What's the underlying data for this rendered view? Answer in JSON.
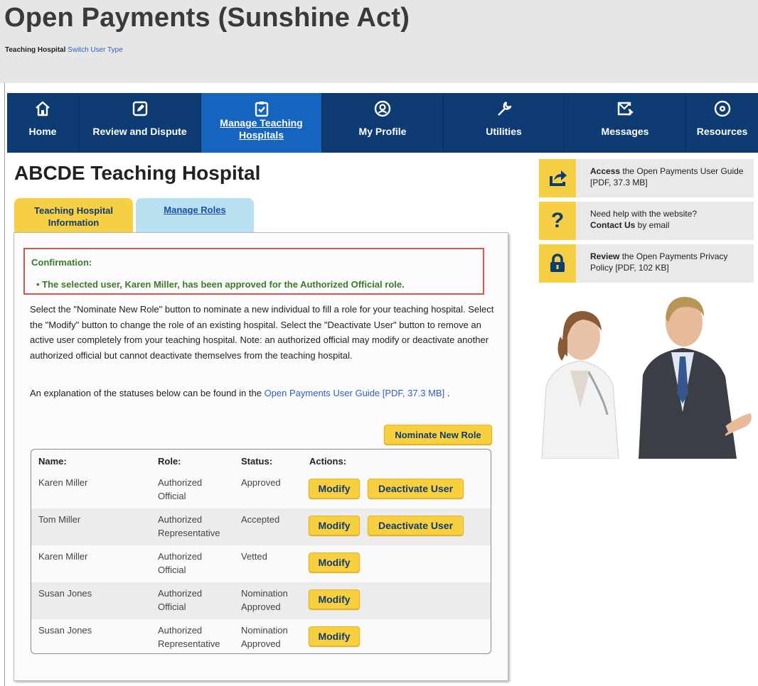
{
  "header": {
    "title": "Open Payments (Sunshine Act)",
    "user_type": "Teaching Hospital",
    "switch_link": "Switch User Type"
  },
  "nav": {
    "items": [
      {
        "label": "Home",
        "icon": "home-icon"
      },
      {
        "label": "Review and Dispute",
        "icon": "edit-icon"
      },
      {
        "label": "Manage Teaching Hospitals",
        "icon": "clipboard-icon",
        "active": true
      },
      {
        "label": "My Profile",
        "icon": "user-icon"
      },
      {
        "label": "Utilities",
        "icon": "wrench-icon"
      },
      {
        "label": "Messages",
        "icon": "mail-icon"
      },
      {
        "label": "Resources",
        "icon": "gear-icon"
      }
    ],
    "active_label_line1": "Manage Teaching",
    "active_label_line2": "Hospitals"
  },
  "main": {
    "title": "ABCDE Teaching Hospital",
    "tabs": {
      "info_line1": "Teaching Hospital",
      "info_line2": "Information",
      "roles": "Manage Roles"
    },
    "confirmation": {
      "title": "Confirmation:",
      "message": "The selected user, Karen Miller, has been approved for the Authorized Official role."
    },
    "instructions": "Select the \"Nominate New Role\" button to nominate a new individual to fill a role for your teaching hospital. Select the \"Modify\" button to change the role of an existing hospital. Select the \"Deactivate User\" button to remove an active user completely from your teaching hospital. Note: an authorized official may modify or deactivate another authorized official but cannot deactivate themselves from the teaching hospital.",
    "explanation_prefix": "An explanation of the statuses below can be found in the",
    "explanation_link": "Open Payments User Guide [PDF, 37.3 MB]",
    "explanation_suffix": ".",
    "nominate_label": "Nominate New Role",
    "table": {
      "headers": {
        "name": "Name:",
        "role": "Role:",
        "status": "Status:",
        "actions": "Actions:"
      },
      "modify_label": "Modify",
      "deactivate_label": "Deactivate User",
      "rows": [
        {
          "name": "Karen Miller",
          "role_line1": "Authorized",
          "role_line2": "Official",
          "status_line1": "Approved",
          "status_line2": ""
        },
        {
          "name": "Tom Miller",
          "role_line1": "Authorized",
          "role_line2": "Representative",
          "status_line1": "Accepted",
          "status_line2": ""
        },
        {
          "name": "Karen Miller",
          "role_line1": "Authorized",
          "role_line2": "Official",
          "status_line1": "Vetted",
          "status_line2": ""
        },
        {
          "name": "Susan Jones",
          "role_line1": "Authorized",
          "role_line2": "Official",
          "status_line1": "Nomination",
          "status_line2": "Approved"
        },
        {
          "name": "Susan Jones",
          "role_line1": "Authorized",
          "role_line2": "Representative",
          "status_line1": "Nomination",
          "status_line2": "Approved"
        }
      ]
    }
  },
  "rail": {
    "guide": {
      "bold": "Access",
      "text": " the Open Payments User Guide [PDF, 37.3 MB]"
    },
    "help": {
      "line1": "Need help with the website?",
      "bold": "Contact Us",
      "text": " by email"
    },
    "privacy": {
      "bold": "Review",
      "text": " the Open Payments Privacy Policy [PDF, 102 KB]"
    }
  },
  "colors": {
    "nav_bg": "#0e3c72",
    "nav_active": "#1565c0",
    "button_yellow": "#f8cf3e",
    "confirm_green": "#3c7a2c",
    "confirm_border": "#d9534f"
  }
}
